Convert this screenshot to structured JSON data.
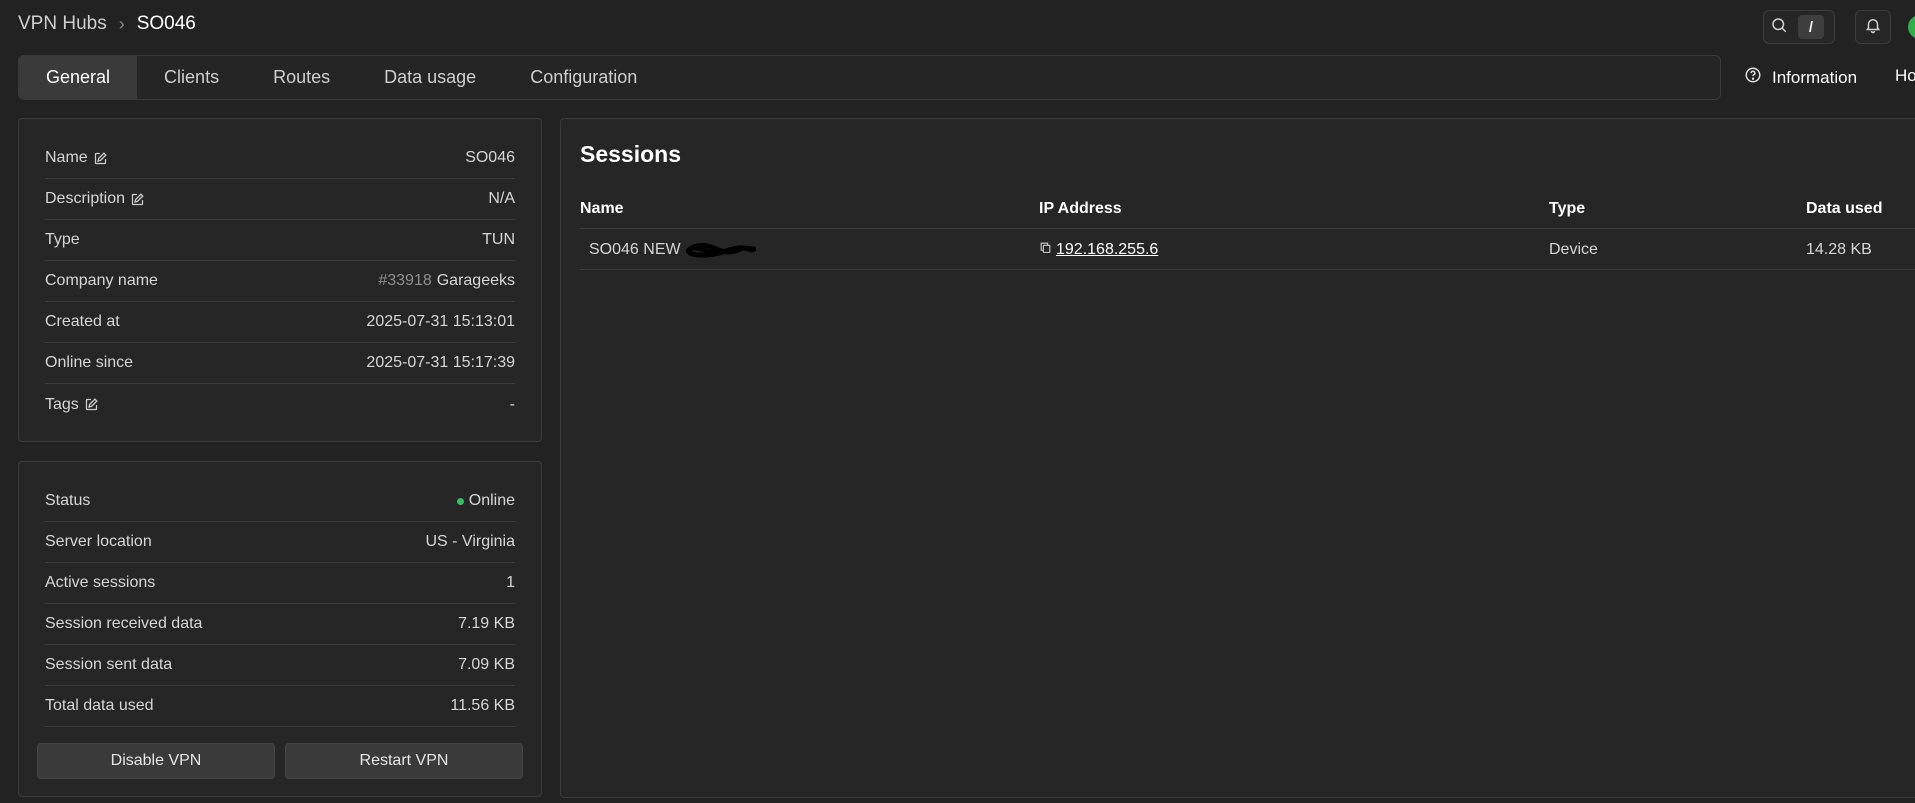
{
  "breadcrumb": {
    "parent": "VPN Hubs",
    "current": "SO046"
  },
  "topbar": {
    "search_shortcut": "/"
  },
  "tabs": [
    {
      "label": "General",
      "active": true
    },
    {
      "label": "Clients",
      "active": false
    },
    {
      "label": "Routes",
      "active": false
    },
    {
      "label": "Data usage",
      "active": false
    },
    {
      "label": "Configuration",
      "active": false
    }
  ],
  "header_links": {
    "information": "Information",
    "partial": "Ho"
  },
  "general": {
    "rows": [
      {
        "label": "Name",
        "value": "SO046",
        "editable": true
      },
      {
        "label": "Description",
        "value": "N/A",
        "editable": true
      },
      {
        "label": "Type",
        "value": "TUN"
      },
      {
        "label": "Company name",
        "id": "#33918",
        "value": "Garageeks"
      },
      {
        "label": "Created at",
        "value": "2025-07-31 15:13:01"
      },
      {
        "label": "Online since",
        "value": "2025-07-31 15:17:39"
      },
      {
        "label": "Tags",
        "value": "-",
        "editable": true
      }
    ]
  },
  "status": {
    "rows": [
      {
        "label": "Status",
        "value": "Online"
      },
      {
        "label": "Server location",
        "value": "US - Virginia"
      },
      {
        "label": "Active sessions",
        "value": "1"
      },
      {
        "label": "Session received data",
        "value": "7.19 KB"
      },
      {
        "label": "Session sent data",
        "value": "7.09 KB"
      },
      {
        "label": "Total data used",
        "value": "11.56 KB"
      }
    ],
    "buttons": {
      "disable": "Disable VPN",
      "restart": "Restart VPN"
    }
  },
  "sessions": {
    "title": "Sessions",
    "columns": {
      "name": "Name",
      "ip": "IP Address",
      "type": "Type",
      "data": "Data used"
    },
    "rows": [
      {
        "name": "SO046 NEW",
        "ip": "192.168.255.6",
        "type": "Device",
        "data": "14.28 KB"
      }
    ]
  },
  "colors": {
    "background": "#222222",
    "card": "#262626",
    "border": "#3a3a3a",
    "online": "#3db86a"
  },
  "icons": [
    "search-icon",
    "bell-icon",
    "question-circle-icon",
    "edit-icon",
    "copy-icon"
  ]
}
